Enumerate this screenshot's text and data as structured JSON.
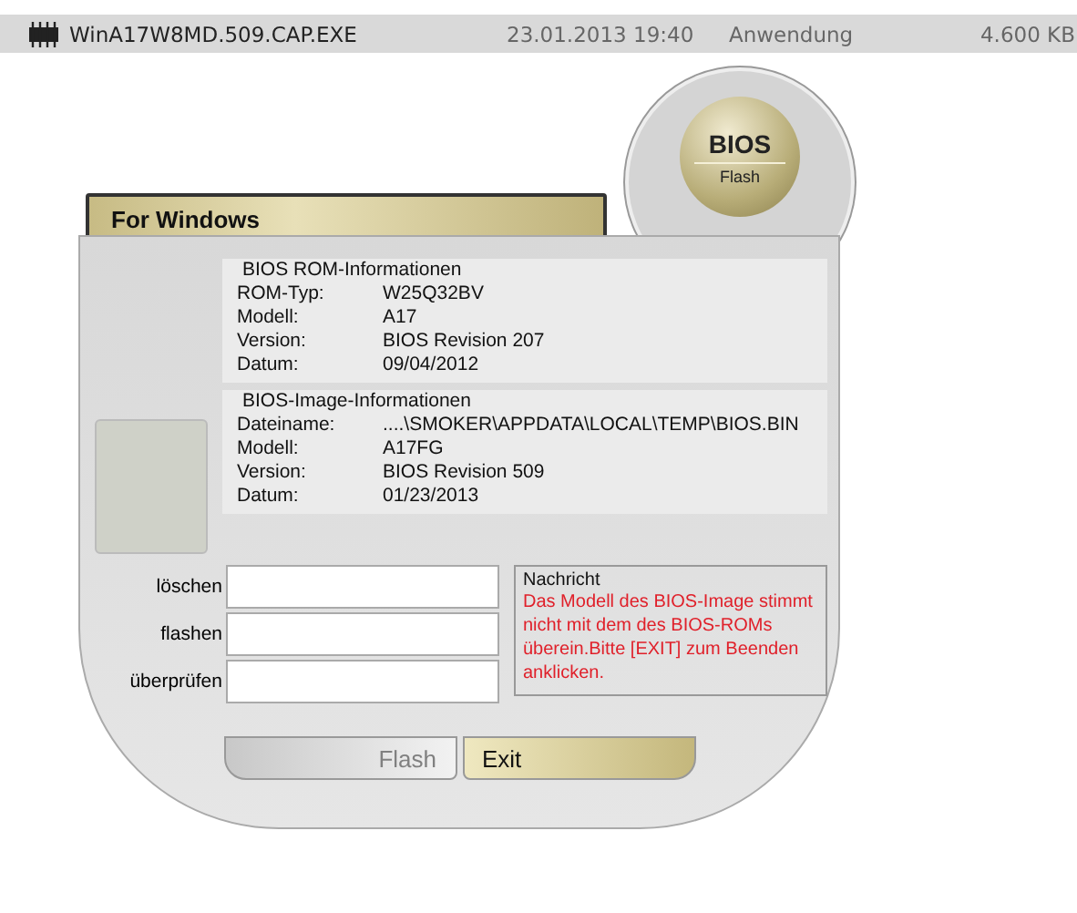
{
  "file_row": {
    "name": "WinA17W8MD.509.CAP.EXE",
    "date": "23.01.2013 19:40",
    "type": "Anwendung",
    "size": "4.600 KB",
    "selected": true
  },
  "logo": {
    "title": "BIOS",
    "subtitle": "Flash"
  },
  "header": "For Windows",
  "rom_info": {
    "title": "BIOS ROM-Informationen",
    "rows": [
      {
        "label": "ROM-Typ:",
        "value": "W25Q32BV"
      },
      {
        "label": "Modell:",
        "value": "A17"
      },
      {
        "label": "Version:",
        "value": "BIOS Revision 207"
      },
      {
        "label": "Datum:",
        "value": "09/04/2012"
      }
    ]
  },
  "image_info": {
    "title": "BIOS-Image-Informationen",
    "rows": [
      {
        "label": "Dateiname:",
        "value": "....\\SMOKER\\APPDATA\\LOCAL\\TEMP\\BIOS.BIN"
      },
      {
        "label": "Modell:",
        "value": "A17FG"
      },
      {
        "label": "Version:",
        "value": "BIOS Revision 509"
      },
      {
        "label": "Datum:",
        "value": "01/23/2013"
      }
    ]
  },
  "progress": [
    {
      "label": "löschen"
    },
    {
      "label": "flashen"
    },
    {
      "label": "überprüfen"
    }
  ],
  "message": {
    "title": "Nachricht",
    "text": "Das Modell des BIOS-Image stimmt nicht mit dem des BIOS-ROMs überein.Bitte [EXIT] zum Beenden anklicken."
  },
  "buttons": [
    {
      "label": "Flash",
      "disabled": true
    },
    {
      "label": "Exit",
      "disabled": false
    }
  ]
}
